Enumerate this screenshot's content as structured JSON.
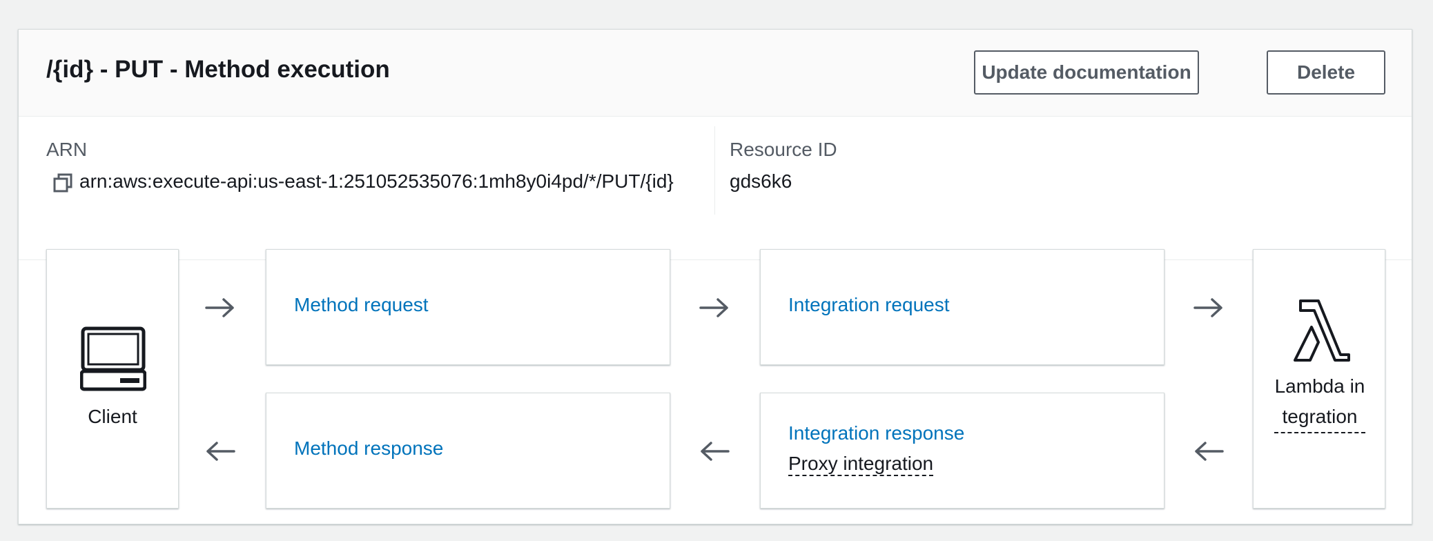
{
  "header": {
    "title": "/{id} - PUT - Method execution",
    "update_label": "Update documentation",
    "delete_label": "Delete"
  },
  "details": {
    "arn_label": "ARN",
    "arn_value": "arn:aws:execute-api:us-east-1:251052535076:1mh8y0i4pd/*/PUT/{id}",
    "resource_id_label": "Resource ID",
    "resource_id_value": "gds6k6"
  },
  "flow": {
    "client_label": "Client",
    "method_request": "Method request",
    "integration_request": "Integration request",
    "method_response": "Method response",
    "integration_response": "Integration response",
    "integration_response_detail": "Proxy integration",
    "backend_label": "Lambda integration"
  },
  "icons": {
    "copy": "copy-icon",
    "client": "computer-icon",
    "backend": "lambda-icon",
    "right_arrow": "arrow-right-icon",
    "left_arrow": "arrow-left-icon"
  },
  "colors": {
    "link": "#0073bb",
    "text": "#16191f",
    "secondary_text": "#545b64",
    "background": "#f1f2f2"
  }
}
